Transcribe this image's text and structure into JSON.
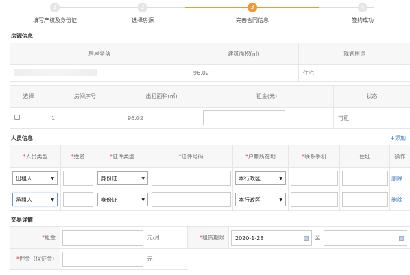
{
  "steps": [
    {
      "num": "1",
      "label": "填写产权及身份证",
      "active": false
    },
    {
      "num": "2",
      "label": "选择房源",
      "active": false
    },
    {
      "num": "3",
      "label": "完善合同信息",
      "active": true
    },
    {
      "num": "4",
      "label": "签约成功",
      "active": false
    }
  ],
  "house_section": {
    "title": "房源信息",
    "headers": [
      "房屋坐落",
      "建筑面积(㎡)",
      "规划用途"
    ],
    "row": {
      "location": "",
      "area": "96.02",
      "usage": "住宅"
    }
  },
  "room_table": {
    "headers": [
      "选择",
      "房间序号",
      "出租面积(㎡)",
      "租金(元)",
      "状态"
    ],
    "row": {
      "index": "1",
      "area": "96.02",
      "rent": "",
      "status": "可租"
    }
  },
  "person_section": {
    "title": "人员信息",
    "add_label": "+添加",
    "headers": {
      "person_type": "人员类型",
      "name": "姓名",
      "id_type": "证件类型",
      "id_number": "证件号码",
      "domicile": "户籍所在地",
      "phone": "联系手机",
      "address": "住址",
      "action": "操作"
    },
    "rows": [
      {
        "person_type": "出租人",
        "id_type": "身份证",
        "domicile": "本行政区",
        "delete_label": "删除"
      },
      {
        "person_type": "承租人",
        "id_type": "身份证",
        "domicile": "本行政区",
        "delete_label": "删除"
      }
    ]
  },
  "deal_section": {
    "title": "交易详情",
    "rent_label": "租金",
    "rent_unit": "元/月",
    "period_label": "租赁期限",
    "period_start": "2020-1-28",
    "to_label": "至",
    "period_end": "",
    "deposit_label": "押金（保证金）",
    "deposit_unit": "元"
  },
  "colors": {
    "accent": "#f09a37",
    "link": "#3a78c8",
    "required": "#e33333"
  }
}
